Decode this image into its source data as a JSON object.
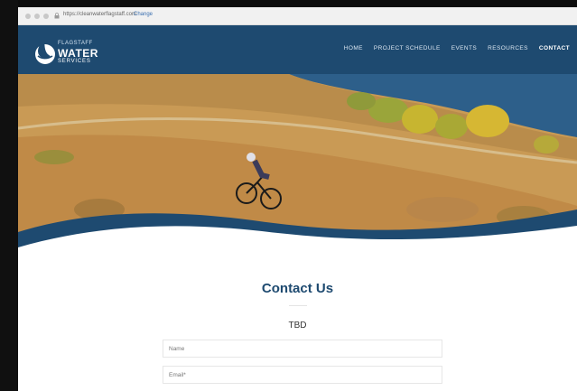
{
  "browser": {
    "url": "https://cleanwaterflagstaff.com",
    "change_label": "Change"
  },
  "logo": {
    "line1": "FLAGSTAFF",
    "line2": "WATER",
    "line3": "SERVICES"
  },
  "nav": {
    "items": [
      "HOME",
      "PROJECT SCHEDULE",
      "EVENTS",
      "RESOURCES",
      "CONTACT"
    ],
    "active": "CONTACT"
  },
  "contact": {
    "title": "Contact Us",
    "subtitle": "TBD",
    "name_placeholder": "Name",
    "email_placeholder": "Email*"
  },
  "colors": {
    "header": "#1e4a70",
    "title": "#1e4a70",
    "wave": "#1e4a70"
  }
}
